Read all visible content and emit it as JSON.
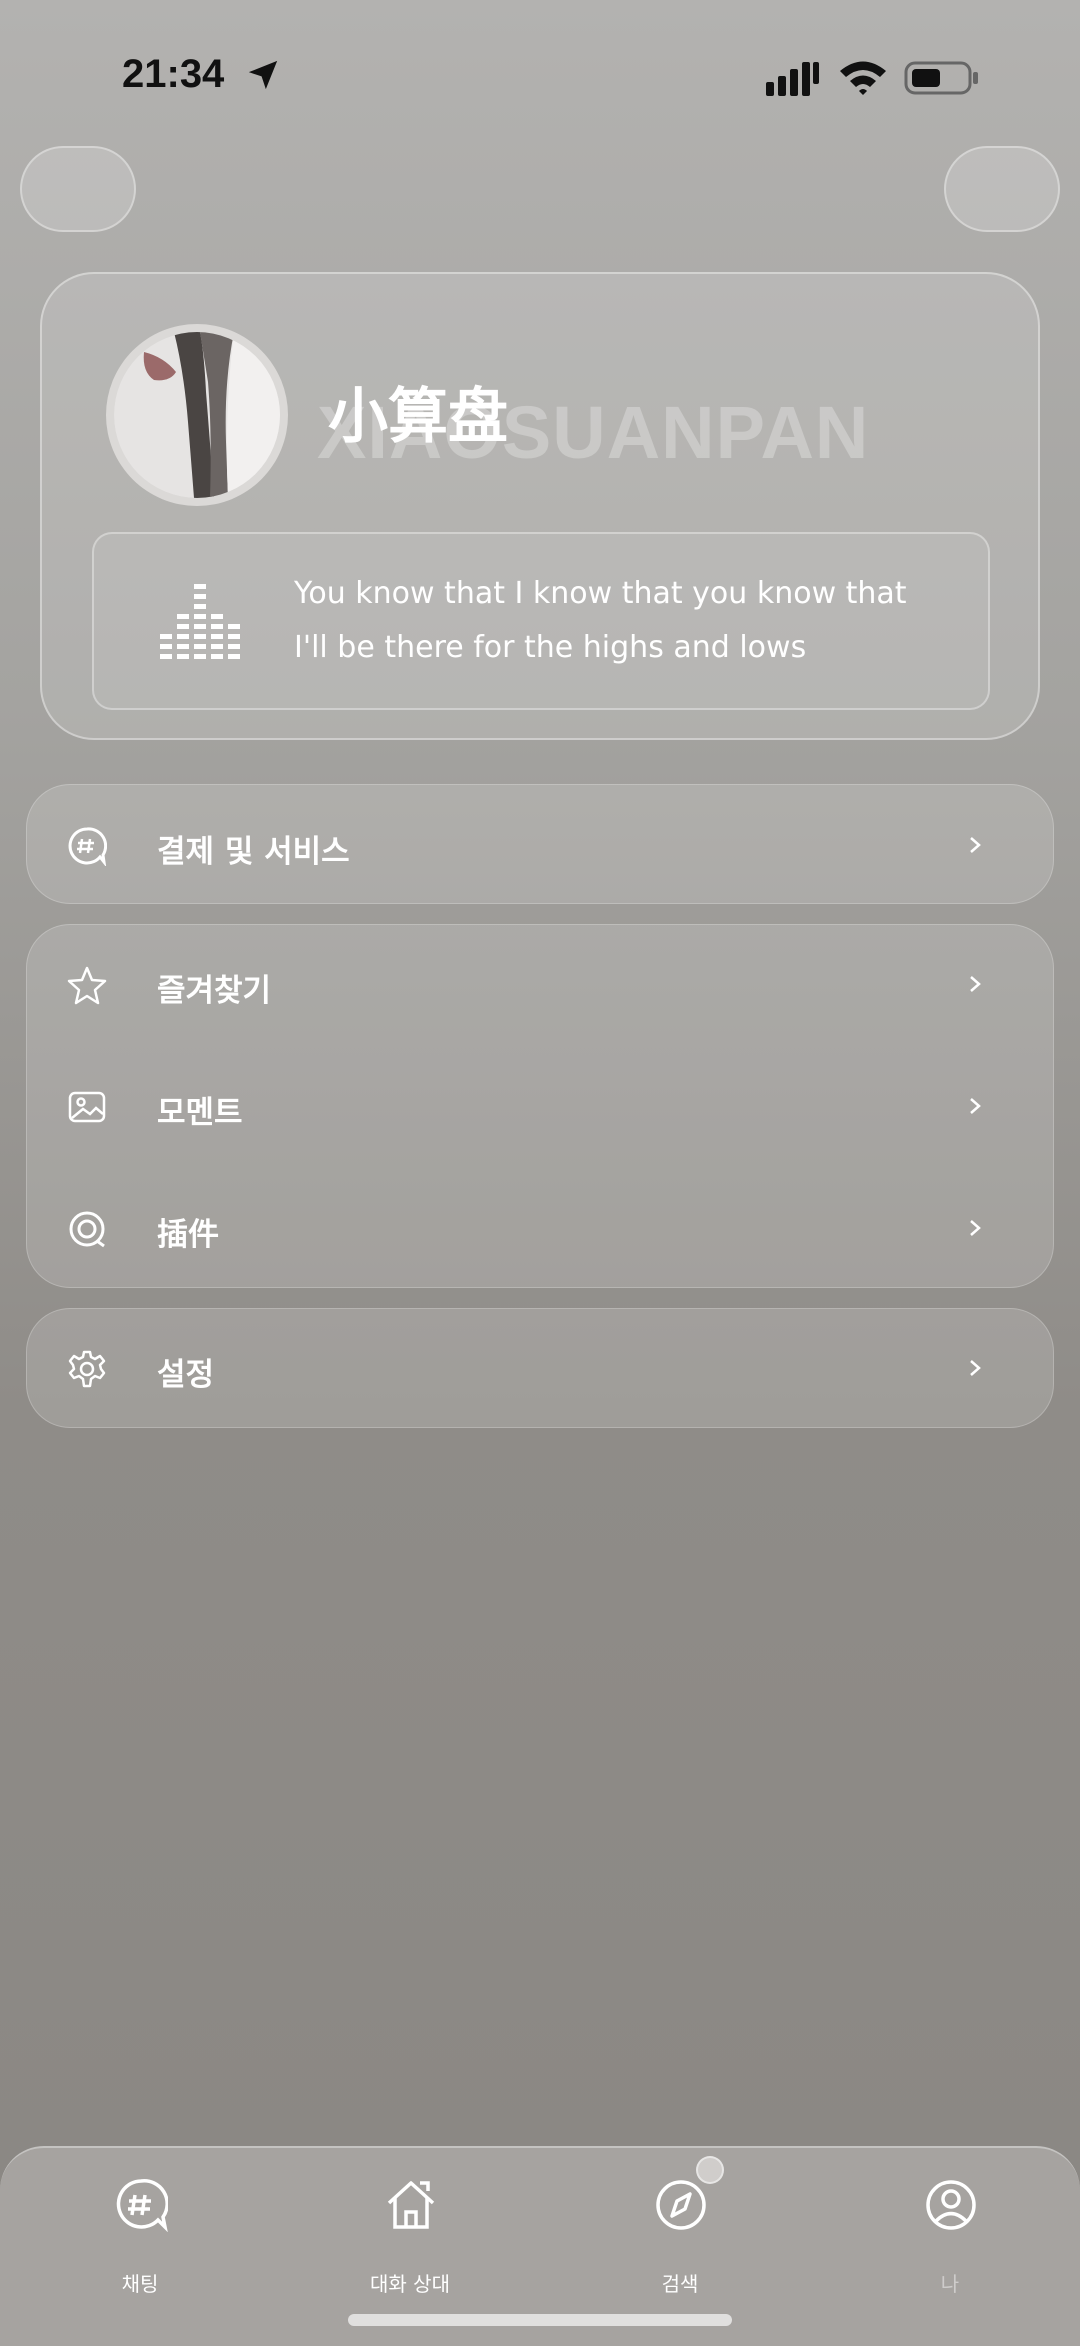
{
  "status_bar": {
    "time": "21:34"
  },
  "profile": {
    "name": "小算盘",
    "watermark": "XIAOSUANPAN",
    "lyrics": [
      "You know that I know that you know that",
      "I'll be there for the highs and lows"
    ]
  },
  "menu": {
    "payment": "결제 및 서비스",
    "favorites": "즐겨찾기",
    "moments": "모멘트",
    "plugins": "插件",
    "settings": "설정"
  },
  "tabs": [
    {
      "label": "채팅",
      "icon": "chat-hash-icon"
    },
    {
      "label": "대화 상대",
      "icon": "home-icon"
    },
    {
      "label": "검색",
      "icon": "compass-icon"
    },
    {
      "label": "나",
      "icon": "user-icon"
    }
  ]
}
